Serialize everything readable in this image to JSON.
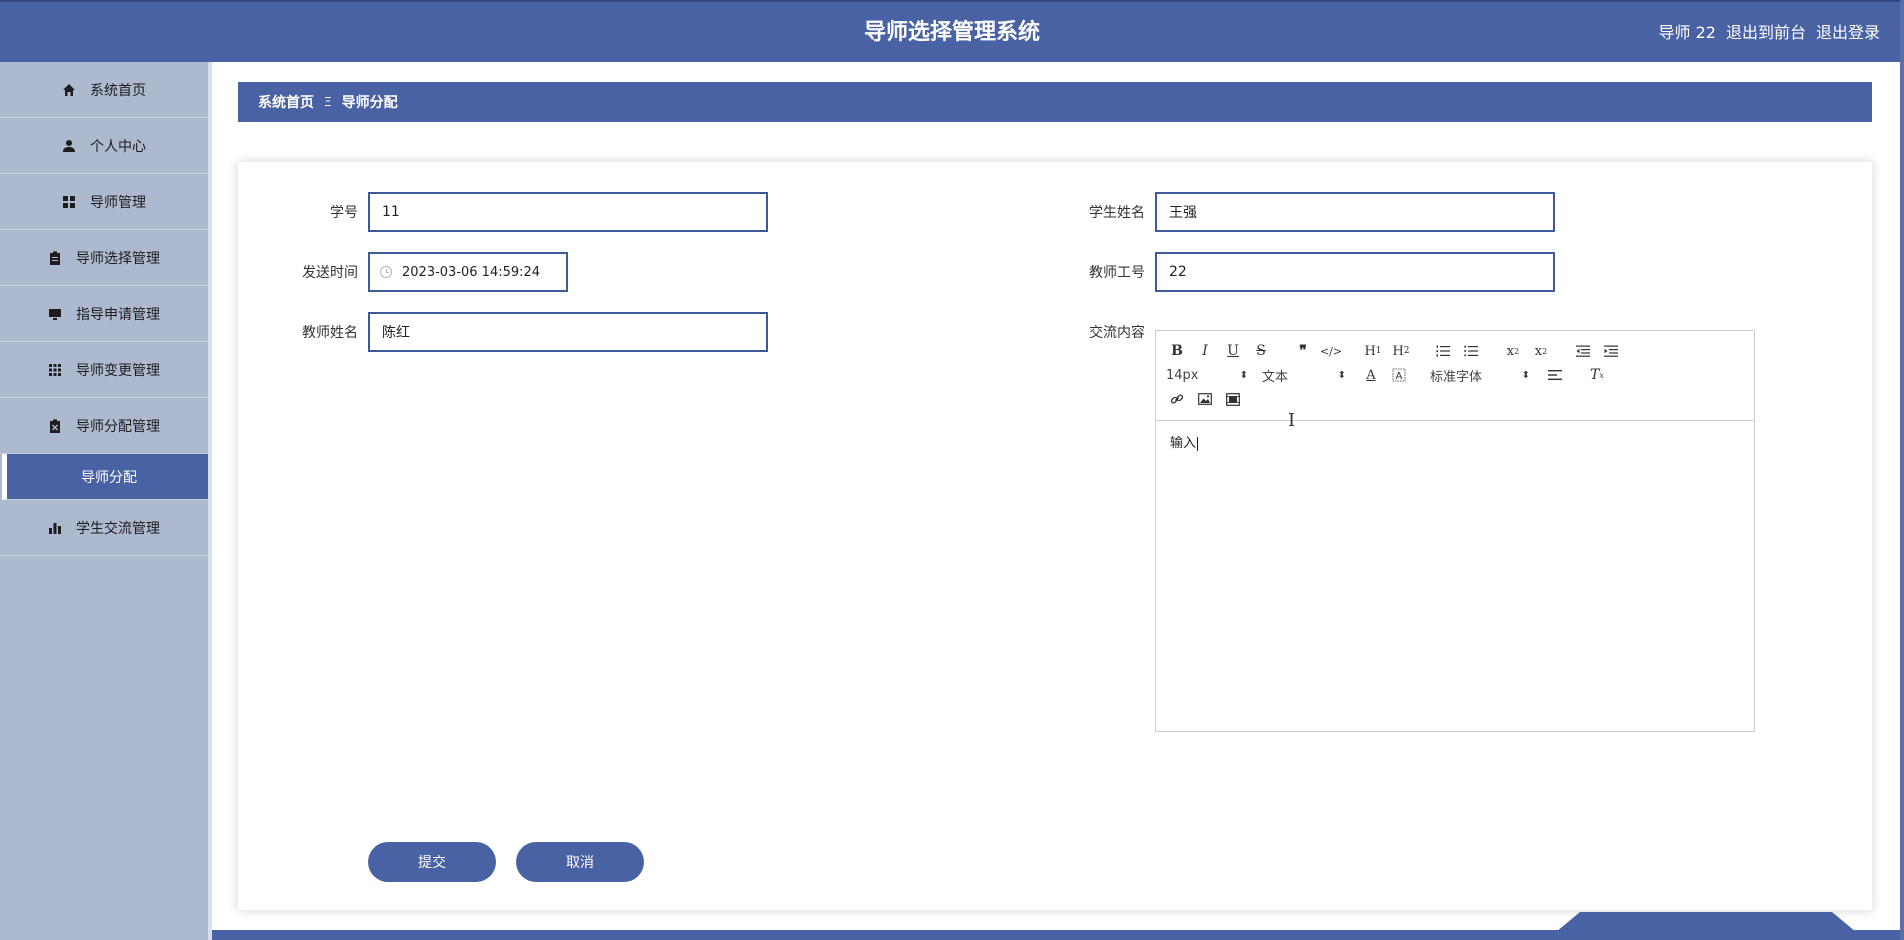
{
  "header": {
    "title": "导师选择管理系统",
    "user": "导师 22",
    "to_front": "退出到前台",
    "logout": "退出登录"
  },
  "sidebar": {
    "items": [
      {
        "label": "系统首页",
        "icon": "home-icon"
      },
      {
        "label": "个人中心",
        "icon": "user-icon"
      },
      {
        "label": "导师管理",
        "icon": "grid-icon"
      },
      {
        "label": "导师选择管理",
        "icon": "clipboard-icon"
      },
      {
        "label": "指导申请管理",
        "icon": "monitor-icon"
      },
      {
        "label": "导师变更管理",
        "icon": "apps-icon"
      },
      {
        "label": "导师分配管理",
        "icon": "clipboard-x-icon"
      },
      {
        "label": "导师分配",
        "sub": true
      },
      {
        "label": "学生交流管理",
        "icon": "bar-chart-icon"
      }
    ]
  },
  "breadcrumb": {
    "home": "系统首页",
    "separator": "Ξ",
    "current": "导师分配"
  },
  "form": {
    "student_no": {
      "label": "学号",
      "value": "11"
    },
    "student_name": {
      "label": "学生姓名",
      "value": "王强"
    },
    "send_time": {
      "label": "发送时间",
      "value": "2023-03-06 14:59:24"
    },
    "teacher_no": {
      "label": "教师工号",
      "value": "22"
    },
    "teacher_name": {
      "label": "教师姓名",
      "value": "陈红"
    },
    "content": {
      "label": "交流内容",
      "value": "输入"
    }
  },
  "editor": {
    "font_size": "14px",
    "block_type": "文本",
    "font_family": "标准字体"
  },
  "buttons": {
    "submit": "提交",
    "cancel": "取消"
  },
  "colors": {
    "primary": "#4962a3",
    "sidebar": "#adb9cf"
  }
}
